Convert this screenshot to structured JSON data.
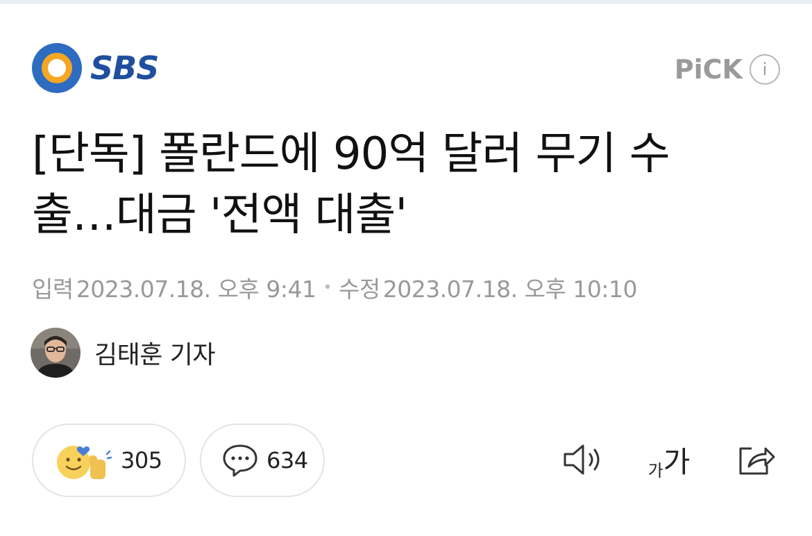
{
  "header": {
    "brand_name": "SBS",
    "pick_label": "PiCK",
    "info_label": "i"
  },
  "article": {
    "headline_line1": "[단독] 폴란드에 90억 달러 무기 수",
    "headline_line2": "출…대금 '전액 대출'",
    "meta": {
      "input_label": "입력",
      "input_datetime": "2023.07.18. 오후 9:41",
      "separator": "•",
      "edit_label": "수정",
      "edit_datetime": "2023.07.18. 오후 10:10"
    },
    "reporter": "김태훈 기자"
  },
  "actions": {
    "reaction_count": "305",
    "comment_count": "634",
    "font_small": "가",
    "font_large": "가"
  },
  "colors": {
    "brand_blue": "#1f4f9e",
    "brand_orange": "#f5a623",
    "meta_gray": "#999999"
  },
  "icons": {
    "logo": "sbs-logo-icon",
    "info": "info-icon",
    "reaction": "smile-thumbs-icon",
    "comment": "speech-bubble-icon",
    "sound": "speaker-icon",
    "font": "font-size-icon",
    "share": "share-icon"
  }
}
